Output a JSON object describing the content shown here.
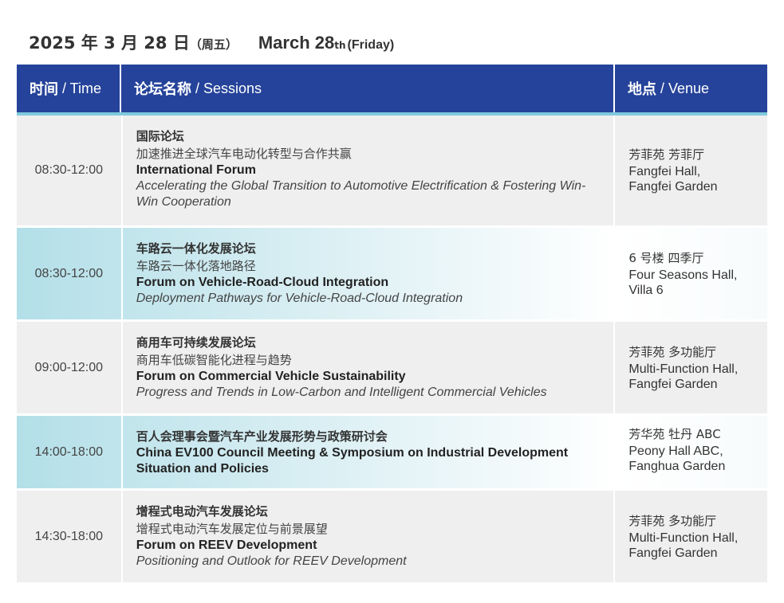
{
  "header": {
    "date_zh": "2025 年 3 月 28 日",
    "weekday_zh": "（周五）",
    "date_en": "March 28",
    "date_en_sup": "th",
    "weekday_en": "(Friday)"
  },
  "table": {
    "columns": {
      "time_zh": "时间",
      "time_en": " / Time",
      "sessions_zh": "论坛名称",
      "sessions_en": " / Sessions",
      "venue_zh": "地点",
      "venue_en": " / Venue"
    },
    "rows": [
      {
        "time": "08:30-12:00",
        "title_zh": "国际论坛",
        "subtitle_zh": "加速推进全球汽车电动化转型与合作共赢",
        "title_en": "International Forum",
        "subtitle_en": "Accelerating the Global Transition to Automotive Electrification & Fostering Win-Win Cooperation",
        "venue_zh": "芳菲苑 芳菲厅",
        "venue_en": "Fangfei Hall, Fangfei Garden"
      },
      {
        "time": "08:30-12:00",
        "title_zh": "车路云一体化发展论坛",
        "subtitle_zh": "车路云一体化落地路径",
        "title_en": "Forum on Vehicle-Road-Cloud Integration",
        "subtitle_en": "Deployment Pathways for Vehicle-Road-Cloud Integration",
        "venue_zh": "6 号楼 四季厅",
        "venue_en": "Four Seasons Hall, Villa 6"
      },
      {
        "time": "09:00-12:00",
        "title_zh": "商用车可持续发展论坛",
        "subtitle_zh": "商用车低碳智能化进程与趋势",
        "title_en": "Forum on Commercial Vehicle Sustainability",
        "subtitle_en": "Progress and Trends in Low-Carbon and Intelligent Commercial Vehicles",
        "venue_zh": "芳菲苑 多功能厅",
        "venue_en": "Multi-Function Hall, Fangfei Garden"
      },
      {
        "time": "14:00-18:00",
        "title_zh": "百人会理事会暨汽车产业发展形势与政策研讨会",
        "title_en": "China EV100 Council Meeting & Symposium on Industrial Development Situation and Policies",
        "venue_zh": "芳华苑 牡丹 ABC",
        "venue_en": "Peony Hall ABC, Fanghua Garden"
      },
      {
        "time": "14:30-18:00",
        "title_zh": "增程式电动汽车发展论坛",
        "subtitle_zh": "增程式电动汽车发展定位与前景展望",
        "title_en": "Forum on REEV Development",
        "subtitle_en": "Positioning and Outlook for REEV Development",
        "venue_zh": "芳菲苑 多功能厅",
        "venue_en": "Multi-Function Hall, Fangfei Garden"
      }
    ]
  },
  "colors": {
    "header_bg": "#25439a",
    "header_accent": "#7fc9dc",
    "row_gray": "#efefef",
    "row_teal": "#b3dfe8"
  }
}
